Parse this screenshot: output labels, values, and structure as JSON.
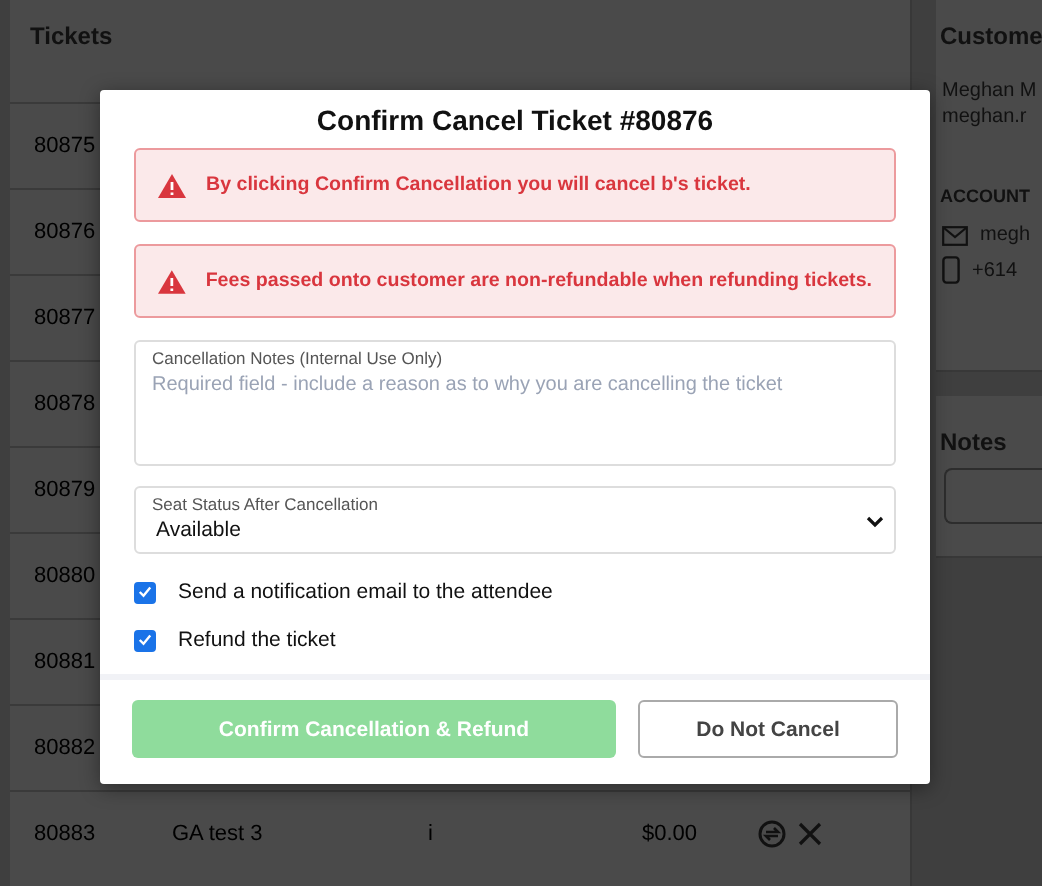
{
  "tickets_panel": {
    "title": "Tickets",
    "rows": [
      {
        "id": "80875"
      },
      {
        "id": "80876"
      },
      {
        "id": "80877"
      },
      {
        "id": "80878"
      },
      {
        "id": "80879"
      },
      {
        "id": "80880"
      },
      {
        "id": "80881"
      },
      {
        "id": "80882"
      },
      {
        "id": "80883",
        "name": "GA test 3",
        "column_3": "i",
        "price": "$0.00"
      }
    ]
  },
  "customer_panel": {
    "title": "Custome",
    "name": "Meghan M",
    "email_short": "meghan.r",
    "section": "ACCOUNT",
    "email": "megh",
    "phone": "+614"
  },
  "notes_panel": {
    "title": "Notes"
  },
  "modal": {
    "title": "Confirm Cancel Ticket #80876",
    "alerts": [
      "By clicking **Confirm Cancellation** you will cancel b's ticket.",
      "Fees passed onto customer are non-refundable when refunding tickets."
    ],
    "notes_field": {
      "label": "Cancellation Notes (Internal Use Only)",
      "placeholder": "Required field - include a reason as to why you are cancelling the ticket"
    },
    "seat_status": {
      "label": "Seat Status After Cancellation",
      "value": "Available"
    },
    "options": [
      {
        "label": "Send a notification email to the attendee",
        "checked": true
      },
      {
        "label": "Refund the ticket",
        "checked": true
      }
    ],
    "confirm_button": {
      "label": "Confirm Cancellation & Refund",
      "disabled": true
    },
    "cancel_button": {
      "label": "Do Not Cancel"
    }
  }
}
